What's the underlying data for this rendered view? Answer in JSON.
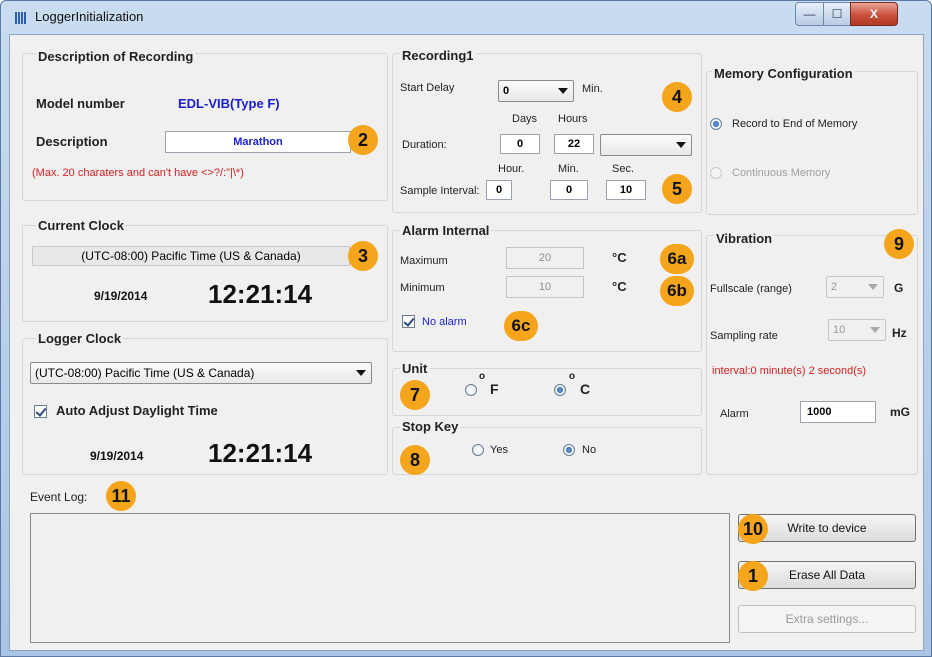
{
  "window": {
    "title": "LoggerInitialization",
    "min_symbol": "—",
    "max_symbol": "☐",
    "close_symbol": "X"
  },
  "description": {
    "title": "Description of Recording",
    "model_label": "Model number",
    "model_value": "EDL-VIB(Type F)",
    "description_label": "Description",
    "description_value": "Marathon",
    "note": "(Max. 20 charaters and can't have <>?/:\"|\\*)"
  },
  "current_clock": {
    "title": "Current Clock",
    "timezone": "(UTC-08:00) Pacific Time (US & Canada)",
    "date": "9/19/2014",
    "time": "12:21:14"
  },
  "logger_clock": {
    "title": "Logger Clock",
    "timezone": "(UTC-08:00) Pacific Time (US & Canada)",
    "auto_adjust_label": "Auto Adjust Daylight Time",
    "date": "9/19/2014",
    "time": "12:21:14"
  },
  "recording": {
    "title": "Recording1",
    "start_delay_label": "Start Delay",
    "start_delay_value": "0",
    "min_unit": "Min.",
    "days_header": "Days",
    "hours_header": "Hours",
    "duration_label": "Duration:",
    "duration_days": "0",
    "duration_hours": "22",
    "duration_unit": "",
    "hour_header": "Hour.",
    "min_header": "Min.",
    "sec_header": "Sec.",
    "sample_label": "Sample Interval:",
    "sample_hour": "0",
    "sample_min": "0",
    "sample_sec": "10"
  },
  "memory": {
    "title": "Memory Configuration",
    "option1": "Record to End of Memory",
    "option2": "Continuous Memory"
  },
  "alarm": {
    "title": "Alarm Internal",
    "max_label": "Maximum",
    "max_value": "20",
    "min_label": "Minimum",
    "min_value": "10",
    "unit": "°C",
    "no_alarm_label": "No alarm"
  },
  "vibration": {
    "title": "Vibration",
    "fullscale_label": "Fullscale (range)",
    "fullscale_value": "2",
    "fullscale_unit": "G",
    "sampling_label": "Sampling rate",
    "sampling_value": "10",
    "sampling_unit": "Hz",
    "interval_text": "interval:0 minute(s) 2 second(s)",
    "alarm_label": "Alarm",
    "alarm_value": "1000",
    "alarm_unit": "mG"
  },
  "unit": {
    "title": "Unit",
    "f_label": "F",
    "c_label": "C",
    "degree": "o"
  },
  "stopkey": {
    "title": "Stop Key",
    "yes_label": "Yes",
    "no_label": "No"
  },
  "event_log": {
    "label": "Event Log:"
  },
  "buttons": {
    "write": "Write to device",
    "erase": "Erase All Data",
    "extra": "Extra settings..."
  },
  "badges": {
    "b1": "1",
    "b2": "2",
    "b3": "3",
    "b4": "4",
    "b5": "5",
    "b6a": "6a",
    "b6b": "6b",
    "b6c": "6c",
    "b7": "7",
    "b8": "8",
    "b9": "9",
    "b10": "10",
    "b11": "11"
  },
  "colors": {
    "model_blue": "#1a1fcc",
    "note_red": "#d42222",
    "badge_orange": "#f5a51b"
  }
}
